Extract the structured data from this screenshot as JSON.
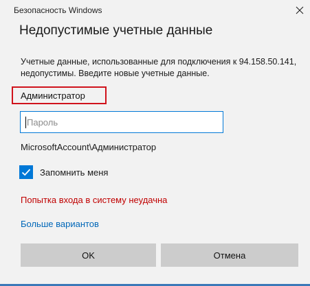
{
  "window": {
    "title": "Безопасность Windows",
    "close_icon": "close-icon"
  },
  "dialog": {
    "heading": "Недопустимые учетные данные",
    "description": "Учетные данные, использованные для подключения к 94.158.50.141, недопустимы. Введите новые учетные данные.",
    "username": "Администратор",
    "password": {
      "value": "",
      "placeholder": "Пароль"
    },
    "account": "MicrosoftAccount\\Администратор",
    "remember": {
      "label": "Запомнить меня",
      "checked": true
    },
    "error": "Попытка входа в систему неудачна",
    "more_options": "Больше вариантов"
  },
  "buttons": {
    "ok": "OK",
    "cancel": "Отмена"
  },
  "colors": {
    "accent": "#0078d7",
    "error": "#c00000",
    "highlight_border": "#d0121b",
    "link": "#0067b8",
    "button_bg": "#cccccc",
    "dialog_bg": "#f2f2f2"
  }
}
